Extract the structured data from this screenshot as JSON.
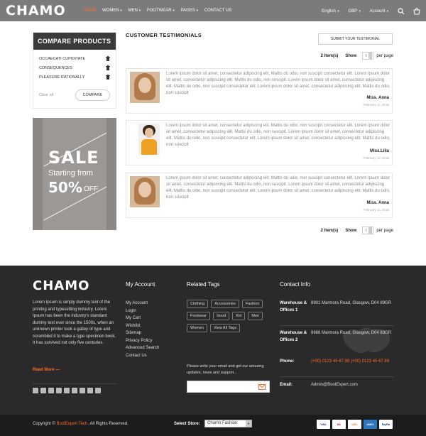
{
  "header": {
    "logo": "CHAMO",
    "nav": [
      {
        "label": "HOME",
        "active": true,
        "caret": false
      },
      {
        "label": "WOMEN",
        "active": false,
        "caret": true
      },
      {
        "label": "MEN",
        "active": false,
        "caret": true
      },
      {
        "label": "FOOTWEAR",
        "active": false,
        "caret": true
      },
      {
        "label": "PAGES",
        "active": false,
        "caret": true
      },
      {
        "label": "CONTACT US",
        "active": false,
        "caret": false
      }
    ],
    "language": "English",
    "currency": "GBP",
    "account": "Account",
    "accent_color": "#ff6a2a"
  },
  "compare": {
    "title": "COMPARE PRODUCTS",
    "items": [
      "OCCAECATI CUPIDITATE",
      "CONSEQUENCES",
      "PLEASURE RATIONALLY"
    ],
    "clear_all": "Clear all",
    "compare_button": "COMPARE"
  },
  "banner": {
    "sale": "SALE",
    "starting": "Starting from",
    "percent": "50%",
    "off": "OFF"
  },
  "main": {
    "title": "CUSTOMER TESTIMONIALS",
    "submit_button": "SUBMIT YOUR TESTIMONIAL",
    "pager": {
      "items": "2 Item(s)",
      "show": "Show",
      "per_page_value": "5",
      "per_page": "per page"
    },
    "testimonials": [
      {
        "text": "Lorem ipsum dolor sit amet, consectetur adipiscing elit. Mattis du odio, non suscipit consectetur elit. Lorem ipsum dolor sit amet, consectetur adipiscing elit. Mattis du odio, non suscipit. Lorem ipsum dolor sit amet, consectetur adipiscing elit. Mattis du odio, non suscipit consectetur elit. Lorem ipsum dolor sit amet, consectetur adipiscing elit. Mattis du odio, non suscipit",
        "name": "Miss. Anna",
        "date": "February 11, 2016"
      },
      {
        "text": "Lorem ipsum dolor sit amet, consectetur adipiscing elit. Mattis du odio, non suscipit consectetur elit. Lorem ipsum dolor sit amet, consectetur adipiscing elit. Mattis du odio, non suscipit. Lorem ipsum dolor sit amet, consectetur adipiscing elit. Mattis du odio, non suscipit consectetur elit. Lorem ipsum dolor sit amet, consectetur adipiscing elit. Mattis du odio, non suscipit",
        "name": "Miss.Lilia",
        "date": "February 11, 2016"
      },
      {
        "text": "Lorem ipsum dolor sit amet, consectetur adipiscing elit. Mattis du odio, non suscipit consectetur elit. Lorem ipsum dolor sit amet, consectetur adipiscing elit. Mattis du odio, non suscipit. Lorem ipsum dolor sit amet, consectetur adipiscing elit. Mattis du odio, non suscipit consectetur elit. Lorem ipsum dolor sit amet, consectetur adipiscing elit. Mattis du odio, non suscipit",
        "name": "Miss. Anna",
        "date": "February 11, 2016"
      }
    ]
  },
  "footer": {
    "logo": "CHAMO",
    "about": "Lorem Ipsum is simply dummy text of the printing and typesetting industry. Lorem Ipsum has been the industry's standard dummy text ever since the 1500s, when an unknown printer took a galley of type and scrambled it to make a type specimen book. It has survived not only five centuries.",
    "read_more": "Read More",
    "account_heading": "My Account",
    "account_links": [
      "My Account",
      "Login",
      "My Cart",
      "Wishlist",
      "Sitemap",
      "Privacy Policy",
      "Advanced Search",
      "Contact Us"
    ],
    "tags_heading": "Related Tags",
    "tags": [
      "Clothing",
      "Accessories",
      "Fashion",
      "Footwear",
      "Good",
      "Kid",
      "Men",
      "Women",
      "View All Tags"
    ],
    "newsletter_text": "Please write your email and get our amazing updates, news and support...",
    "contact_heading": "Contact Info",
    "contacts": [
      {
        "label": "Warehouse & Offices 1",
        "value": "8901 Marmora Road, Glasgow, D04 89GR",
        "highlight": false
      },
      {
        "label": "Warehouse & Offices 2",
        "value": "8666 Marmora Road, Glasgow, D04 89GR",
        "highlight": false
      },
      {
        "label": "Phone:",
        "value": "(+00) 0123 45 67 89 (+00) 0123 45 67 89",
        "highlight": true
      },
      {
        "label": "Email:",
        "value": "Admin@BootExpert.com",
        "highlight": false
      }
    ]
  },
  "bottom": {
    "copyright_prefix": "Copyright ©",
    "copyright_brand": "BootExpert Tech",
    "copyright_suffix": ". All Rights Reserved.",
    "store_label": "Select Store:",
    "store_value": "Chamo Fashion",
    "payments": [
      "VISA",
      "MC",
      "DISC",
      "AMEX",
      "PayPal"
    ]
  }
}
